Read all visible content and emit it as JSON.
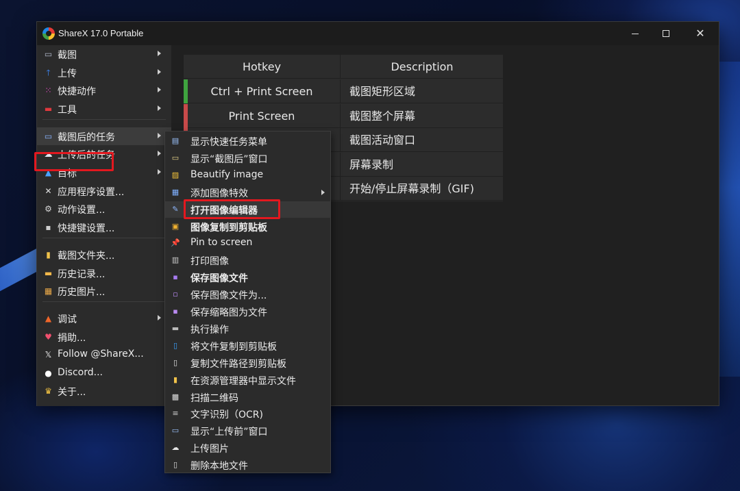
{
  "window": {
    "title": "ShareX 17.0 Portable",
    "minimize_glyph": "",
    "maximize_glyph": "",
    "close_glyph": "✕"
  },
  "main_menu": {
    "items": [
      {
        "label": "截图",
        "icon": "capture-icon",
        "has_submenu": true
      },
      {
        "label": "上传",
        "icon": "upload-arrow-icon",
        "has_submenu": true
      },
      {
        "label": "快捷动作",
        "icon": "grid-dots-icon",
        "has_submenu": true
      },
      {
        "label": "工具",
        "icon": "toolbox-icon",
        "has_submenu": true
      },
      {
        "label": "截图后的任务",
        "icon": "after-capture-icon",
        "has_submenu": true
      },
      {
        "label": "上传后的任务",
        "icon": "cloud-icon",
        "has_submenu": true
      },
      {
        "label": "目标",
        "icon": "destination-icon",
        "has_submenu": true
      },
      {
        "label": "应用程序设置...",
        "icon": "wrench-icon",
        "has_submenu": false
      },
      {
        "label": "动作设置...",
        "icon": "gear-icon",
        "has_submenu": false
      },
      {
        "label": "快捷键设置...",
        "icon": "keyboard-icon",
        "has_submenu": false
      },
      {
        "label": "截图文件夹...",
        "icon": "folder-icon",
        "has_submenu": false
      },
      {
        "label": "历史记录...",
        "icon": "history-icon",
        "has_submenu": false
      },
      {
        "label": "历史图片...",
        "icon": "image-history-icon",
        "has_submenu": false
      },
      {
        "label": "调试",
        "icon": "traffic-cone-icon",
        "has_submenu": true
      },
      {
        "label": "捐助...",
        "icon": "heart-icon",
        "has_submenu": false
      },
      {
        "label": "Follow @ShareX...",
        "icon": "x-logo-icon",
        "has_submenu": false
      },
      {
        "label": "Discord...",
        "icon": "discord-icon",
        "has_submenu": false
      },
      {
        "label": "关于...",
        "icon": "crown-icon",
        "has_submenu": false
      }
    ]
  },
  "hotkey_table": {
    "headers": {
      "hotkey": "Hotkey",
      "description": "Description"
    },
    "rows": [
      {
        "hotkey": "Ctrl + Print Screen",
        "description": "截图矩形区域",
        "status_color": "#3fa33f"
      },
      {
        "hotkey": "Print Screen",
        "description": "截图整个屏幕",
        "status_color": "#c84a4a"
      },
      {
        "hotkey": "",
        "description": "截图活动窗口",
        "status_color": "#c84a4a"
      },
      {
        "hotkey": "",
        "description": "屏幕录制",
        "status_color": "#c84a4a"
      },
      {
        "hotkey": "",
        "description": "开始/停止屏幕录制（GIF)",
        "status_color": "#c84a4a"
      }
    ]
  },
  "submenu": {
    "items": [
      {
        "label": "显示快速任务菜单",
        "icon": "quick-menu-icon",
        "bold": false,
        "has_submenu": false
      },
      {
        "label": "显示“截图后”窗口",
        "icon": "window-icon",
        "bold": false,
        "has_submenu": false
      },
      {
        "label": "Beautify image",
        "icon": "beautify-icon",
        "bold": false,
        "has_submenu": false
      },
      {
        "label": "添加图像特效",
        "icon": "effects-icon",
        "bold": false,
        "has_submenu": true
      },
      {
        "label": "打开图像编辑器",
        "icon": "image-editor-icon",
        "bold": true,
        "has_submenu": false
      },
      {
        "label": "图像复制到剪贴板",
        "icon": "clipboard-image-icon",
        "bold": true,
        "has_submenu": false
      },
      {
        "label": "Pin to screen",
        "icon": "pin-icon",
        "bold": false,
        "has_submenu": false
      },
      {
        "label": "打印图像",
        "icon": "printer-icon",
        "bold": false,
        "has_submenu": false
      },
      {
        "label": "保存图像文件",
        "icon": "save-icon",
        "bold": true,
        "has_submenu": false
      },
      {
        "label": "保存图像文件为...",
        "icon": "save-as-icon",
        "bold": false,
        "has_submenu": false
      },
      {
        "label": "保存缩略图为文件",
        "icon": "thumbnail-icon",
        "bold": false,
        "has_submenu": false
      },
      {
        "label": "执行操作",
        "icon": "terminal-icon",
        "bold": false,
        "has_submenu": false
      },
      {
        "label": "将文件复制到剪贴板",
        "icon": "copy-file-icon",
        "bold": false,
        "has_submenu": false
      },
      {
        "label": "复制文件路径到剪贴板",
        "icon": "copy-path-icon",
        "bold": false,
        "has_submenu": false
      },
      {
        "label": "在资源管理器中显示文件",
        "icon": "explorer-icon",
        "bold": false,
        "has_submenu": false
      },
      {
        "label": "扫描二维码",
        "icon": "qr-code-icon",
        "bold": false,
        "has_submenu": false
      },
      {
        "label": "文字识别（OCR)",
        "icon": "ocr-icon",
        "bold": false,
        "has_submenu": false
      },
      {
        "label": "显示“上传前”窗口",
        "icon": "upload-window-icon",
        "bold": false,
        "has_submenu": false
      },
      {
        "label": "上传图片",
        "icon": "cloud-upload-icon",
        "bold": false,
        "has_submenu": false
      },
      {
        "label": "删除本地文件",
        "icon": "delete-file-icon",
        "bold": false,
        "has_submenu": false
      }
    ]
  },
  "colors": {
    "highlight_box": "#e3181f",
    "status_enabled": "#3fa33f",
    "status_disabled": "#c84a4a",
    "window_bg": "#202020",
    "menu_bg": "#2b2b2b"
  }
}
